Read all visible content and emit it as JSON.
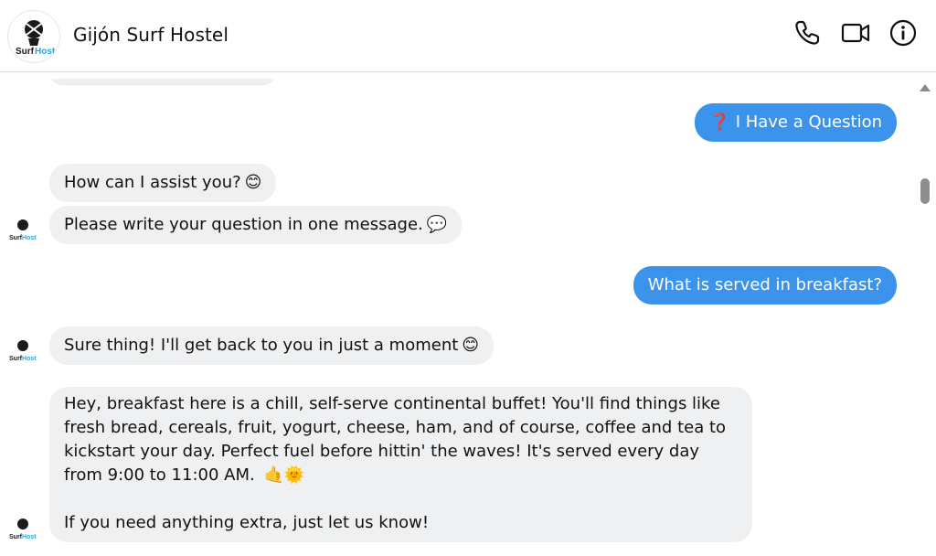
{
  "header": {
    "title": "Gijón Surf Hostel",
    "logo_text_surf": "Surf",
    "logo_text_hostel": "Hostel",
    "actions": [
      {
        "name": "phone-icon"
      },
      {
        "name": "video-icon"
      },
      {
        "name": "info-icon"
      }
    ]
  },
  "messages": [
    {
      "from": "user",
      "emoji": "❓",
      "text": "I Have a Question"
    },
    {
      "from": "bot",
      "text": "How can I assist you?",
      "emoji": "😊"
    },
    {
      "from": "bot",
      "text": "Please write your question in one message.",
      "emoji": "💬"
    },
    {
      "from": "user",
      "text": "What is served in breakfast?"
    },
    {
      "from": "bot",
      "text": "Sure thing! I'll get back to you in just a moment",
      "emoji": "😊"
    },
    {
      "from": "bot",
      "text": "Hey, breakfast here is a chill, self-serve continental buffet! You'll find things like fresh bread, cereals, fruit, yogurt, cheese, ham, and of course, coffee and tea to kickstart your day. Perfect fuel before hittin' the waves! It's served every day from 9:00 to 11:00 AM.",
      "emoji": "🤙🌞",
      "text2": "If you need anything extra, just let us know!"
    }
  ],
  "colors": {
    "outgoing_bubble": "#3b93ec",
    "incoming_bubble": "#eef0f2",
    "header_text": "#111111"
  }
}
